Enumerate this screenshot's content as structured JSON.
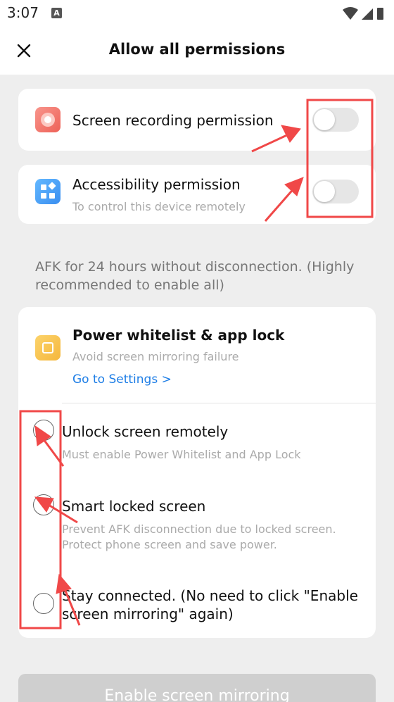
{
  "status_bar": {
    "time": "3:07",
    "notification_letter": "A"
  },
  "header": {
    "title": "Allow all permissions"
  },
  "screen_recording": {
    "label": "Screen recording permission"
  },
  "accessibility": {
    "label": "Accessibility permission",
    "subtitle": "To control this device remotely"
  },
  "afk_note": "AFK for 24 hours without disconnection. (Highly recommended to enable all)",
  "power_whitelist": {
    "title": "Power whitelist & app lock",
    "subtitle": "Avoid screen mirroring failure",
    "link": "Go to Settings >"
  },
  "options": [
    {
      "title": "Unlock screen remotely",
      "subtitle": "Must enable Power Whitelist and App Lock"
    },
    {
      "title": "Smart locked screen",
      "subtitle_line1": "Prevent AFK disconnection due to locked screen.",
      "subtitle_line2": "Protect phone screen and save power."
    },
    {
      "title_line1": "Stay connected. (No need to click \"Enable",
      "title_line2": "screen mirroring\" again)"
    }
  ],
  "bottom_button": {
    "label": "Enable screen mirroring"
  },
  "colors": {
    "link": "#1e7ee6",
    "annotation_red": "#f04848",
    "toggle_off": "#e6e6e6"
  },
  "icons": [
    "close-icon",
    "screen-recording-icon",
    "accessibility-icon",
    "power-whitelist-icon",
    "wifi-icon",
    "signal-icon",
    "battery-icon"
  ]
}
